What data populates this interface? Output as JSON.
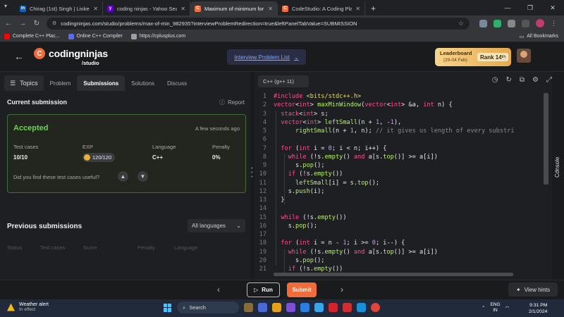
{
  "browser": {
    "tabs": [
      {
        "label": "Chirag (1st) Singh | LinkedIn",
        "fav_color": "#0a66c2",
        "fav_glyph": "in"
      },
      {
        "label": "coding ninjas - Yahoo Search R",
        "fav_color": "#6001d2",
        "fav_glyph": "y"
      },
      {
        "label": "Maximum of minimum for eve",
        "fav_color": "#f26b3a",
        "fav_glyph": "C"
      },
      {
        "label": "CodeStudio: A Coding Platform",
        "fav_color": "#f26b3a",
        "fav_glyph": "C"
      }
    ],
    "active_tab": 2,
    "url": "codingninjas.com/studio/problems/max-of-min_982935?interviewProblemRedirection=true&leftPanelTabValue=SUBMISSION",
    "bookmarks": [
      {
        "label": "Complete C++ Plac...",
        "color": "#ff0000"
      },
      {
        "label": "Online C++ Compiler",
        "color": "#5b6cf0"
      },
      {
        "label": "https://cplusplus.com",
        "color": "#9aa0a6"
      }
    ],
    "all_bookmarks": "All Bookmarks"
  },
  "header": {
    "brand": "codingninjas",
    "brand_sub": "/studio",
    "interview_link": "Interview Problem List",
    "leaderboard": {
      "title": "Leaderboard",
      "dates": "(29-04 Feb)",
      "rank_label": "Rank",
      "rank_value": "14",
      "rank_suffix": "th"
    }
  },
  "left": {
    "topics": "Topics",
    "tabs": [
      "Problem",
      "Submissions",
      "Solutions",
      "Discuss"
    ],
    "active_tab": 1,
    "current_title": "Current submission",
    "report": "Report",
    "card": {
      "status": "Accepted",
      "time": "A few seconds ago",
      "test_cases_label": "Test cases",
      "test_cases_value": "10/10",
      "exp_label": "EXP",
      "exp_value": "120/120",
      "language_label": "Language",
      "language_value": "C++",
      "penalty_label": "Penalty",
      "penalty_value": "0%",
      "useful_question": "Did you find these test cases useful?"
    },
    "previous_title": "Previous submissions",
    "language_filter": "All languages",
    "columns": [
      "Status",
      "Test cases",
      "Score",
      "Penalty",
      "Language"
    ]
  },
  "editor": {
    "language": "C++ (g++ 11)",
    "lines": [
      "#include <bits/stdc++.h>",
      "vector<int> maxMinWindow(vector<int> &a, int n) {",
      "  stack<int> s;",
      "  vector<int> leftSmall(n + 1, -1),",
      "      rightSmall(n + 1, n); // it gives us length of every substri",
      "",
      "  for (int i = 0; i < n; i++) {",
      "    while (!s.empty() and a[s.top()] >= a[i])",
      "      s.pop();",
      "    if (!s.empty())",
      "      leftSmall[i] = s.top();",
      "    s.push(i);",
      "  }",
      "",
      "  while (!s.empty())",
      "    s.pop();",
      "",
      "  for (int i = n - 1; i >= 0; i--) {",
      "    while (!s.empty() and a[s.top()] >= a[i])",
      "      s.pop();",
      "    if (!s.empty())"
    ],
    "line_numbers": [
      "1",
      "2",
      "3",
      "4",
      "5",
      "6",
      "7",
      "8",
      "9",
      "10",
      "11",
      "12",
      "13",
      "14",
      "15",
      "16",
      "17",
      "18",
      "19",
      "20",
      "21"
    ],
    "console_label": "Console"
  },
  "bottom": {
    "run": "Run",
    "submit": "Submit",
    "hints": "View hints"
  },
  "taskbar": {
    "weather_title": "Weather alert",
    "weather_sub": "In effect",
    "search": "Search",
    "lang_top": "ENG",
    "lang_bottom": "IN",
    "time": "9:31 PM",
    "date": "2/1/2024"
  },
  "colors": {
    "accent": "#f26b3a",
    "accepted": "#6fcf5a",
    "link": "#7fa8ff"
  }
}
